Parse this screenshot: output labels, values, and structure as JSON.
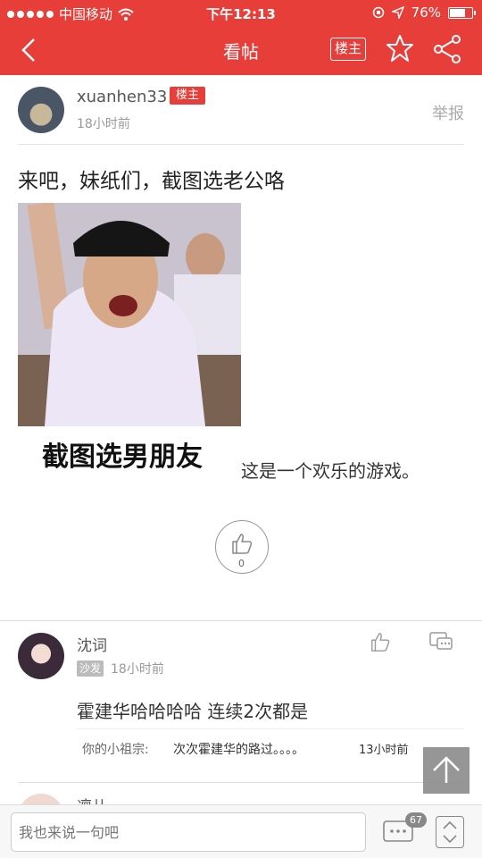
{
  "status_bar": {
    "carrier": "中国移动",
    "time": "下午12:13",
    "battery": "76%",
    "battery_level": 0.76
  },
  "header": {
    "title": "看帖",
    "louzhu_label": "楼主"
  },
  "post": {
    "author": "xuanhen33",
    "author_badge": "楼主",
    "time": "18小时前",
    "report_label": "举报",
    "title": "来吧，妹纸们，截图选老公咯",
    "image_caption": "截图选男朋友",
    "body_text": "这是一个欢乐的游戏。",
    "like_count": "0"
  },
  "comment": {
    "author": "沈词",
    "badge": "沙发",
    "time": "18小时前",
    "text": "霍建华哈哈哈哈 连续2次都是",
    "reply": {
      "user": "你的小祖宗:",
      "text": "次次霍建华的路过。。。。",
      "time": "13小时前"
    }
  },
  "next_comment": {
    "author": "凛儿"
  },
  "bottom_bar": {
    "placeholder": "我也来说一句吧",
    "message_count": "67"
  },
  "colors": {
    "brand_red": "#e83e3a"
  }
}
